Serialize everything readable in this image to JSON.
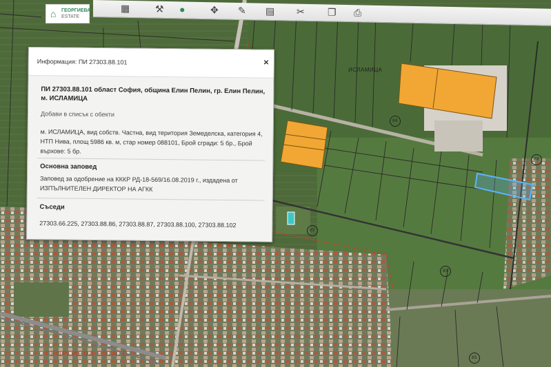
{
  "map": {
    "locality_label": "ИСЛАМИЦА",
    "road_numbers": [
      "88",
      "89",
      "85",
      "89",
      "85"
    ]
  },
  "logo": {
    "line1": "ГЕОРГИЕВА",
    "line2": "ESTATE"
  },
  "watermark": "ГЕОРГИЕВА ESTATE",
  "toolbar": {
    "icons": [
      "layers-icon",
      "tools-icon",
      "info-icon",
      "pin-icon",
      "measure-icon",
      "edit-icon",
      "share-icon",
      "print-icon"
    ]
  },
  "popup": {
    "title": "Информация: ПИ 27303.88.101",
    "close_label": "×",
    "heading": "ПИ 27303.88.101 област София, община Елин Пелин, гр. Елин Пелин, м. ИСЛАМИЦА",
    "add_link": "Добави в списък с обекти",
    "details": "м. ИСЛАМИЦА, вид собств. Частна, вид територия Земеделска, категория 4, НТП Нива, площ 5986 кв. м, стар номер 088101, Брой сгради: 5 бр., Брой върхове: 5 бр.",
    "order_title": "Основна заповед",
    "order_text": "Заповед за одобрение на КККР РД-18-569/16.08.2019 г., издадена от ИЗПЪЛНИТЕЛЕН ДИРЕКТОР НА АГКК",
    "neighbors_title": "Съседи",
    "neighbors": "27303.66.225, 27303.88.86, 27303.88.87, 27303.88.100, 27303.88.102"
  },
  "colors": {
    "highlight": "#5ab4ff",
    "building": "#f2a734",
    "popup_bg": "#f3f4f1"
  }
}
